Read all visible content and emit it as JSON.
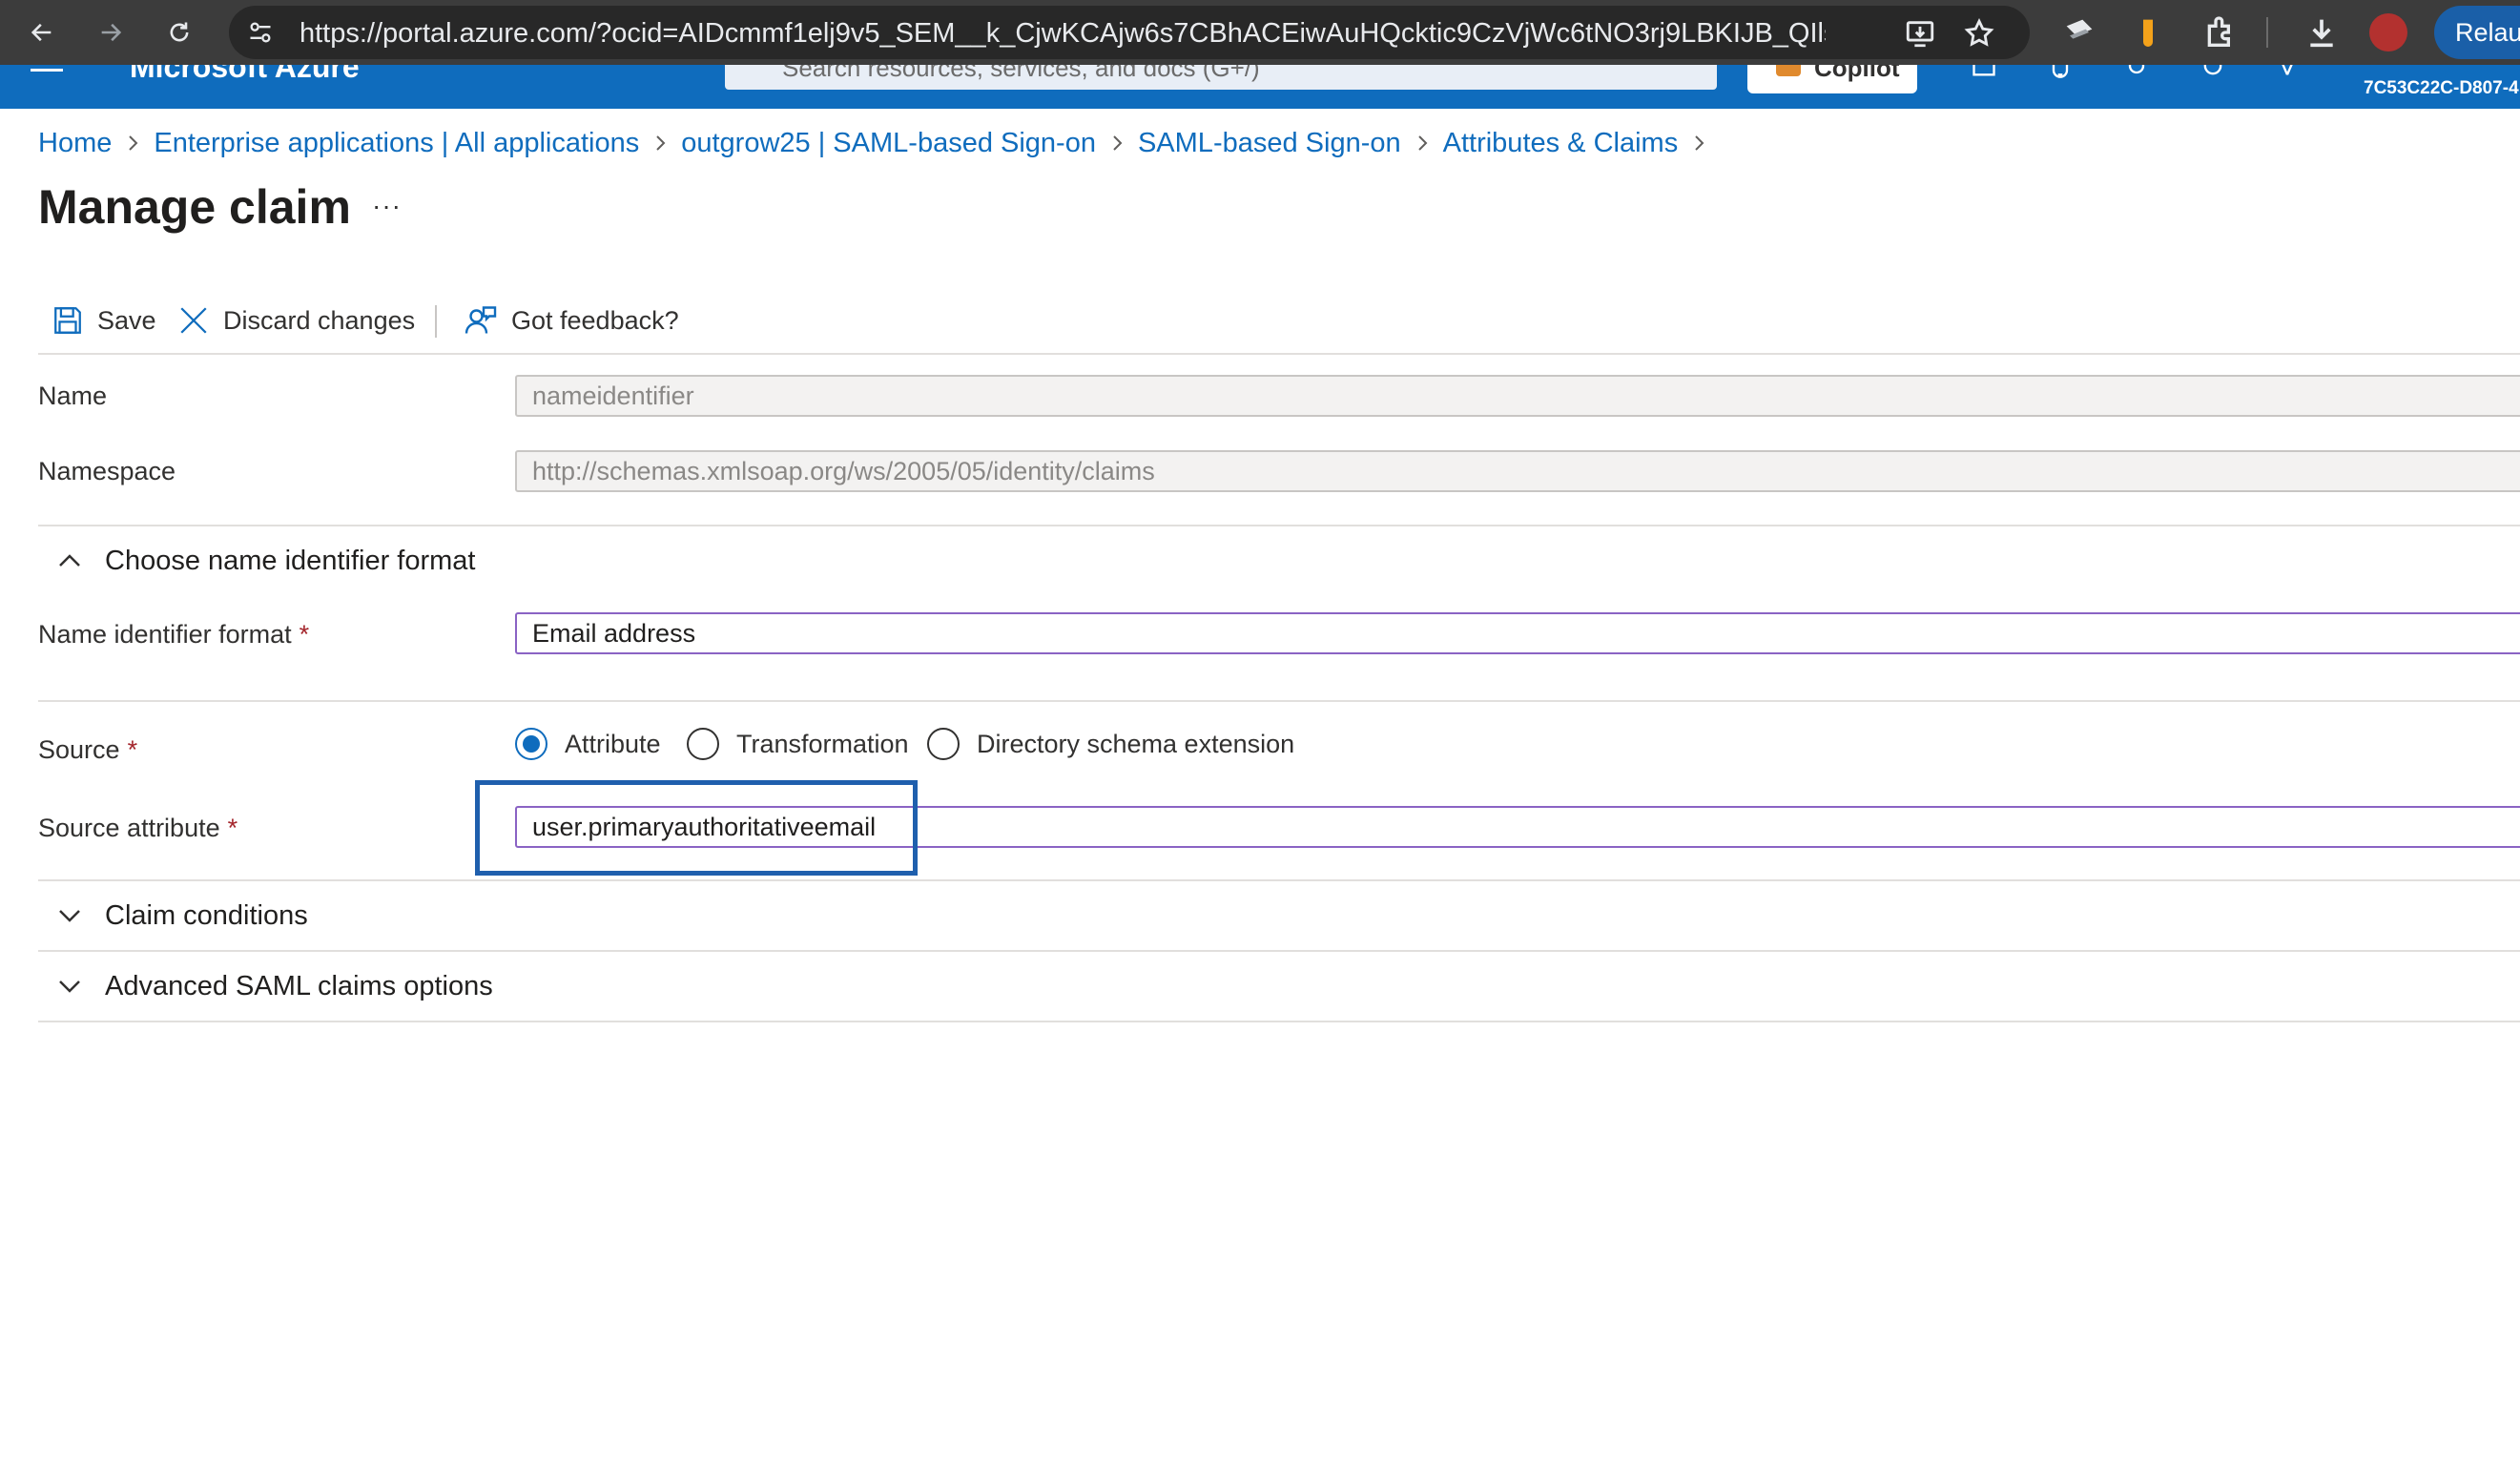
{
  "browser": {
    "url": "https://portal.azure.com/?ocid=AIDcmmf1elj9v5_SEM__k_CjwKCAjw6s7CBhACEiwAuHQcktic9CzVjWc6tNO3rj9LBKIJB_QIls...",
    "relaunch_label": "Relau"
  },
  "azure_bar": {
    "brand": "Microsoft Azure",
    "search_placeholder": "Search resources, services, and docs (G+/)",
    "copilot_label": "Copilot",
    "tenant_id": "7C53C22C-D807-4"
  },
  "breadcrumb": [
    "Home",
    "Enterprise applications | All applications",
    "outgrow25 | SAML-based Sign-on",
    "SAML-based Sign-on",
    "Attributes & Claims"
  ],
  "page": {
    "title": "Manage claim",
    "more_label": "···"
  },
  "toolbar": {
    "save_label": "Save",
    "discard_label": "Discard changes",
    "feedback_label": "Got feedback?"
  },
  "form": {
    "name_label": "Name",
    "name_value": "nameidentifier",
    "namespace_label": "Namespace",
    "namespace_value": "http://schemas.xmlsoap.org/ws/2005/05/identity/claims",
    "name_id_section": "Choose name identifier format",
    "name_id_format_label": "Name identifier format",
    "name_id_format_value": "Email address",
    "source_label": "Source",
    "source_options": [
      "Attribute",
      "Transformation",
      "Directory schema extension"
    ],
    "source_selected": "Attribute",
    "source_attribute_label": "Source attribute",
    "source_attribute_value": "user.primaryauthoritativeemail",
    "required_mark": "*",
    "claim_conditions_label": "Claim conditions",
    "advanced_label": "Advanced SAML claims options"
  },
  "colors": {
    "accent": "#0f6cbd",
    "highlight": "#1f5fad",
    "focus_border": "#8a63c4",
    "required": "#a4262c"
  }
}
